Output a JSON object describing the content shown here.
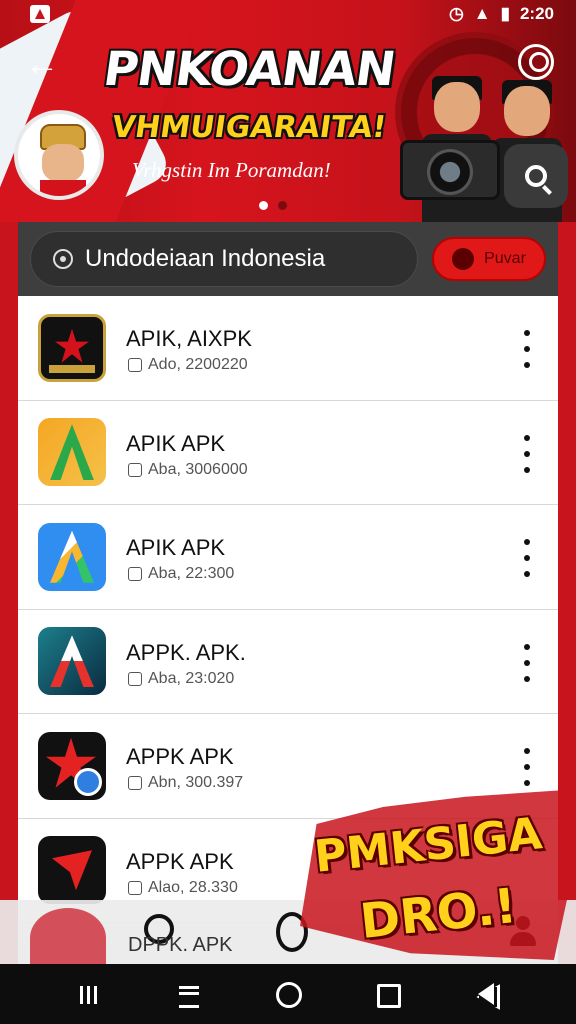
{
  "status_bar": {
    "time": "2:20",
    "icons": [
      "alarm-icon",
      "wifi-icon",
      "battery-icon"
    ]
  },
  "hero": {
    "title": "PNKOANAN",
    "subtitle": "VHMUIGARAITA!",
    "tagline": "Vrhgstin Im Poramdan!",
    "accent_color": "#c8141c",
    "highlight_color": "#ffd11a"
  },
  "search": {
    "value": "Undodeiaan Indonesia",
    "action_label": "Puvar"
  },
  "apps": [
    {
      "name": "APIK, AIXPK",
      "meta": "Ado, 2200220",
      "icon": "shield-star-icon"
    },
    {
      "name": "APIK APK",
      "meta": "Aba, 3006000",
      "icon": "green-a-icon"
    },
    {
      "name": "APIK APK",
      "meta": "Aba, 22:300",
      "icon": "blue-a-icon"
    },
    {
      "name": "APPK. APK.",
      "meta": "Aba, 23:020",
      "icon": "teal-a-icon"
    },
    {
      "name": "APPK APK",
      "meta": "Abn, 300.397",
      "icon": "red-star-icon"
    },
    {
      "name": "APPK APK",
      "meta": "Alao, 28.330",
      "icon": "red-arrow-icon"
    }
  ],
  "partial_row": {
    "name": "DPPK. APK"
  },
  "promo": {
    "line1": "PMKSIGA",
    "line2": "DRO.!"
  }
}
